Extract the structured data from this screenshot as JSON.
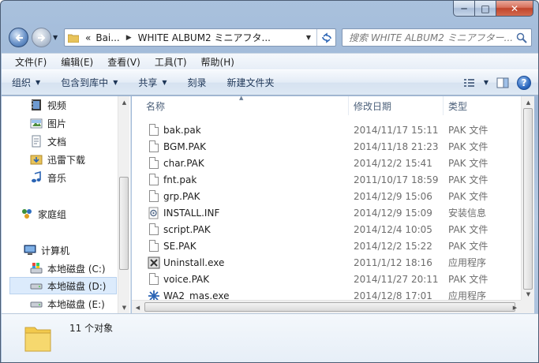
{
  "window": {
    "caption": {
      "minimize": "─",
      "maximize": "□",
      "close": "✕"
    }
  },
  "navigation": {
    "address_prefix": "«",
    "breadcrumb": [
      "Bai...",
      "WHITE ALBUM2 ミニアフタ..."
    ],
    "search_placeholder": "搜索 WHITE ALBUM2 ミニアフター..."
  },
  "menubar": {
    "items": [
      "文件(F)",
      "编辑(E)",
      "查看(V)",
      "工具(T)",
      "帮助(H)"
    ]
  },
  "commandbar": {
    "items": [
      {
        "label": "组织",
        "dropdown": true
      },
      {
        "label": "包含到库中",
        "dropdown": true
      },
      {
        "label": "共享",
        "dropdown": true
      },
      {
        "label": "刻录",
        "dropdown": false
      },
      {
        "label": "新建文件夹",
        "dropdown": false
      }
    ],
    "help": "?"
  },
  "navpane": {
    "items": [
      {
        "label": "视频",
        "icon": "video-library-icon",
        "selected": false
      },
      {
        "label": "图片",
        "icon": "picture-library-icon",
        "selected": false
      },
      {
        "label": "文档",
        "icon": "document-library-icon",
        "selected": false
      },
      {
        "label": "迅雷下载",
        "icon": "thunder-download-icon",
        "selected": false
      },
      {
        "label": "音乐",
        "icon": "music-library-icon",
        "selected": false
      },
      {
        "label": "家庭组",
        "icon": "homegroup-icon",
        "selected": false
      },
      {
        "label": "计算机",
        "icon": "computer-icon",
        "selected": false
      },
      {
        "label": "本地磁盘 (C:)",
        "icon": "system-drive-icon",
        "selected": false
      },
      {
        "label": "本地磁盘 (D:)",
        "icon": "drive-icon",
        "selected": true
      },
      {
        "label": "本地磁盘 (E:)",
        "icon": "drive-icon",
        "selected": false
      }
    ]
  },
  "filelist": {
    "columns": {
      "name": "名称",
      "date": "修改日期",
      "type": "类型"
    },
    "files": [
      {
        "name": "bak.pak",
        "date": "2014/11/17 15:11",
        "type": "PAK 文件",
        "icon": "file-icon"
      },
      {
        "name": "BGM.PAK",
        "date": "2014/11/18 21:23",
        "type": "PAK 文件",
        "icon": "file-icon"
      },
      {
        "name": "char.PAK",
        "date": "2014/12/2 15:41",
        "type": "PAK 文件",
        "icon": "file-icon"
      },
      {
        "name": "fnt.pak",
        "date": "2011/10/17 18:59",
        "type": "PAK 文件",
        "icon": "file-icon"
      },
      {
        "name": "grp.PAK",
        "date": "2014/12/9 15:06",
        "type": "PAK 文件",
        "icon": "file-icon"
      },
      {
        "name": "INSTALL.INF",
        "date": "2014/12/9 15:09",
        "type": "安装信息",
        "icon": "setup-info-icon"
      },
      {
        "name": "script.PAK",
        "date": "2014/12/4 10:05",
        "type": "PAK 文件",
        "icon": "file-icon"
      },
      {
        "name": "SE.PAK",
        "date": "2014/12/2 15:22",
        "type": "PAK 文件",
        "icon": "file-icon"
      },
      {
        "name": "Uninstall.exe",
        "date": "2011/1/12 18:16",
        "type": "应用程序",
        "icon": "uninstall-exe-icon"
      },
      {
        "name": "voice.PAK",
        "date": "2014/11/27 20:11",
        "type": "PAK 文件",
        "icon": "file-icon"
      },
      {
        "name": "WA2_mas.exe",
        "date": "2014/12/8 17:01",
        "type": "应用程序",
        "icon": "app-exe-icon"
      }
    ]
  },
  "details": {
    "count": "11 个对象"
  },
  "colors": {
    "selection": "#dcebfc",
    "link_blue": "#2b64b4",
    "folder_yellow": "#f2c94c"
  }
}
